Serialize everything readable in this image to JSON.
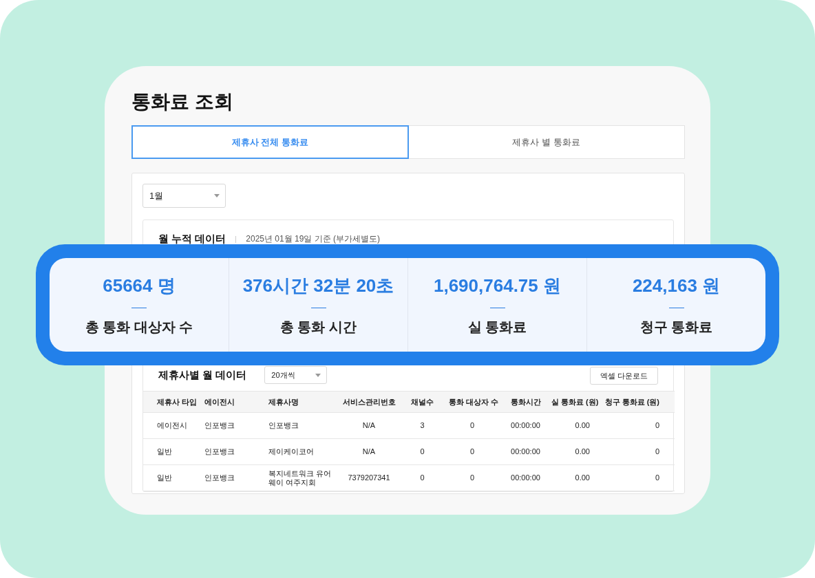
{
  "page_title": "통화료 조회",
  "tabs": [
    {
      "label": "제휴사 전체 통화료",
      "selected": true
    },
    {
      "label": "제휴사 별 통화료",
      "selected": false
    }
  ],
  "month_select": {
    "value": "1월"
  },
  "monthly_summary": {
    "title": "월 누적 데이터",
    "basis": "2025년 01월 19일 기준 (부가세별도)"
  },
  "stats": [
    {
      "value": "65664 명",
      "label": "총 통화 대상자 수"
    },
    {
      "value": "376시간 32분 20초",
      "label": "총 통화 시간"
    },
    {
      "value": "1,690,764.75 원",
      "label": "실 통화료"
    },
    {
      "value": "224,163 원",
      "label": "청구 통화료"
    }
  ],
  "partner_section": {
    "title": "제휴사별 월 데이터",
    "page_size": "20개씩",
    "download_button": "엑셀 다운로드"
  },
  "table": {
    "columns": [
      "제휴사 타입",
      "에이전시",
      "제휴사명",
      "서비스관리번호",
      "채널수",
      "통화 대상자 수",
      "통화시간",
      "실 통화료 (원)",
      "청구 통화료 (원)"
    ],
    "rows": [
      [
        "에이전시",
        "인포뱅크",
        "인포뱅크",
        "N/A",
        "3",
        "0",
        "00:00:00",
        "0.00",
        "0"
      ],
      [
        "일반",
        "인포뱅크",
        "제이케이코어",
        "N/A",
        "0",
        "0",
        "00:00:00",
        "0.00",
        "0"
      ],
      [
        "일반",
        "인포뱅크",
        "복지네트워크 유어웨이 여주지회",
        "7379207341",
        "0",
        "0",
        "00:00:00",
        "0.00",
        "0"
      ]
    ]
  }
}
